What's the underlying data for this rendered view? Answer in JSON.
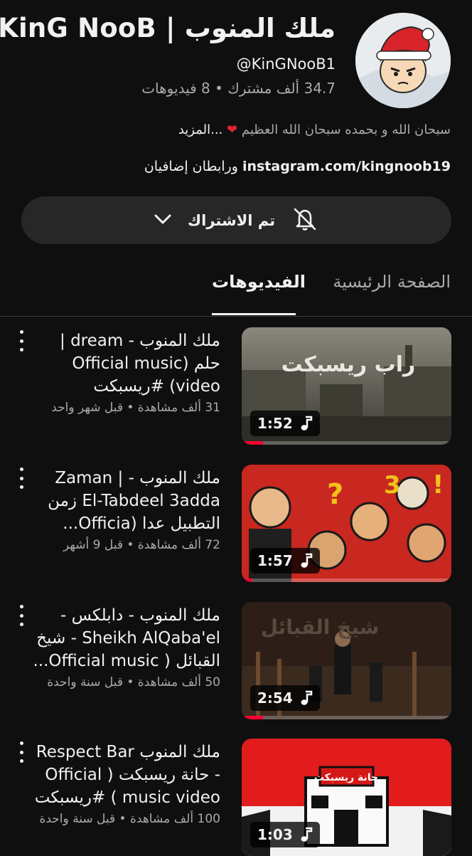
{
  "channel": {
    "name": "KinG NooB | ملك المنوب",
    "handle": "@KinGNooB1",
    "stats": "34.7 ألف مشترك • 8 فيديوهات",
    "description": "سبحان الله و بحمده سبحان الله العظيم",
    "description_more": "...المزيد",
    "link_url": "instagram.com/kingnoob19",
    "link_extra": "ورابطان إضافيان",
    "subscribe_label": "تم الاشتراك"
  },
  "tabs": [
    {
      "label": "الصفحة الرئيسية",
      "active": false
    },
    {
      "label": "الفيديوهات",
      "active": true
    }
  ],
  "videos": [
    {
      "title": "ملك المنوب - dream | حلم (Official music video) #ريسبكت",
      "meta": "31 ألف مشاهدة • قبل شهر واحد",
      "duration": "1:52",
      "thumb_text": "راب ريسبكت",
      "watched_fraction": 0.1
    },
    {
      "title": "ملك المنوب - Zaman | El-Tabdeel 3adda زمن التطبيل عدا (Officia...",
      "meta": "72 ألف مشاهدة • قبل 9 أشهر",
      "duration": "1:57",
      "thumb_text": "3",
      "watched_fraction": 0.05
    },
    {
      "title": "ملك المنوب - دابلكس - Sheikh AlQaba'el - شيخ القبائل ( Official music...",
      "meta": "50 ألف مشاهدة • قبل سنة واحدة",
      "duration": "2:54",
      "thumb_text": "شيخ القبائل",
      "watched_fraction": 0.1
    },
    {
      "title": "ملك المنوب Respect Bar - حانة ريسبكت ( Official music video ) #ريسبكت",
      "meta": "100 ألف مشاهدة • قبل سنة واحدة",
      "duration": "1:03",
      "thumb_text": "حانة ريسبكت",
      "watched_fraction": 0
    }
  ]
}
